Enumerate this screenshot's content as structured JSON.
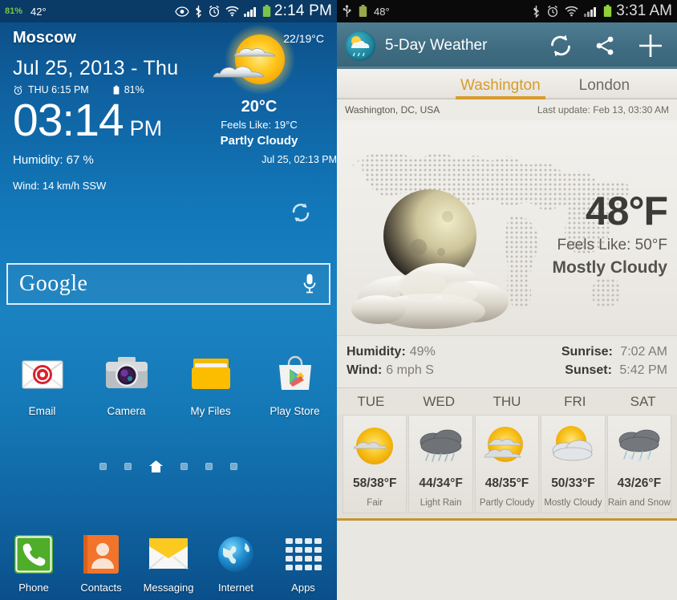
{
  "left_phone": {
    "status_bar": {
      "battery_percent": "81%",
      "outside_temp": "42°",
      "clock": "2:14 PM",
      "icons": [
        "eye-icon",
        "bluetooth-icon",
        "alarm-icon",
        "wifi-icon",
        "signal-icon",
        "battery-icon"
      ]
    },
    "weather_widget": {
      "city": "Moscow",
      "high_low": "22/19°C",
      "date": "Jul 25, 2013 - Thu",
      "alarm_time": "THU 6:15 PM",
      "battery": "81%",
      "clock_time": "03:14",
      "clock_ampm": "PM",
      "humidity": "Humidity: 67 %",
      "wind": "Wind: 14 km/h SSW",
      "temp": "20°C",
      "feels_like": "Feels Like: 19°C",
      "condition": "Partly Cloudy",
      "last_update": "Jul 25, 02:13 PM",
      "condition_icon": "sun-behind-clouds-icon",
      "refresh_icon": "refresh-icon"
    },
    "search_bar": {
      "label": "Google",
      "mic_icon": "microphone-icon"
    },
    "apps": [
      {
        "label": "Email",
        "icon": "email-icon"
      },
      {
        "label": "Camera",
        "icon": "camera-icon"
      },
      {
        "label": "My Files",
        "icon": "folder-icon"
      },
      {
        "label": "Play Store",
        "icon": "play-store-icon"
      }
    ],
    "page_indicator": {
      "count": 6,
      "home_index": 2,
      "home_icon": "home-icon"
    },
    "dock": [
      {
        "label": "Phone",
        "icon": "phone-icon"
      },
      {
        "label": "Contacts",
        "icon": "contacts-icon"
      },
      {
        "label": "Messaging",
        "icon": "messaging-icon"
      },
      {
        "label": "Internet",
        "icon": "globe-icon"
      },
      {
        "label": "Apps",
        "icon": "apps-grid-icon"
      }
    ]
  },
  "right_phone": {
    "status_bar": {
      "usb_icon": "usb-icon",
      "battery_icon": "battery-icon",
      "outside_temp": "48°",
      "clock": "3:31 AM",
      "icons": [
        "bluetooth-icon",
        "alarm-icon",
        "wifi-icon",
        "signal-icon",
        "battery-icon"
      ]
    },
    "app_bar": {
      "title": "5-Day Weather",
      "app_icon": "weather-app-icon",
      "actions": [
        {
          "name": "refresh-icon",
          "label": "Refresh"
        },
        {
          "name": "share-icon",
          "label": "Share"
        },
        {
          "name": "plus-icon",
          "label": "Add"
        }
      ]
    },
    "tabs": [
      {
        "label": "Washington",
        "active": true
      },
      {
        "label": "London",
        "active": false
      }
    ],
    "location_line": {
      "location": "Washington, DC, USA",
      "last_update": "Last update: Feb 13, 03:30 AM"
    },
    "current": {
      "temperature": "48°F",
      "feels_like": "Feels Like: 50°F",
      "condition": "Mostly Cloudy",
      "hero_icon": "moon-behind-clouds-icon",
      "background": "dotted-world-map"
    },
    "stats": {
      "humidity_label": "Humidity:",
      "humidity_value": "49%",
      "wind_label": "Wind:",
      "wind_value": "6 mph S",
      "sunrise_label": "Sunrise:",
      "sunrise_value": "7:02 AM",
      "sunset_label": "Sunset:",
      "sunset_value": "5:42 PM"
    },
    "forecast": [
      {
        "day": "TUE",
        "temps": "58/38°F",
        "desc": "Fair",
        "icon": "sun-cloud-icon"
      },
      {
        "day": "WED",
        "temps": "44/34°F",
        "desc": "Light Rain",
        "icon": "rain-cloud-icon"
      },
      {
        "day": "THU",
        "temps": "48/35°F",
        "desc": "Partly Cloudy",
        "icon": "sun-cloud-icon"
      },
      {
        "day": "FRI",
        "temps": "50/33°F",
        "desc": "Mostly Cloudy",
        "icon": "cloud-sun-icon"
      },
      {
        "day": "SAT",
        "temps": "43/26°F",
        "desc": "Rain and Snow",
        "icon": "rain-snow-icon"
      }
    ]
  },
  "colors": {
    "left_bg_top": "#0b4a80",
    "left_bg_mid": "#1b82c2",
    "status_bar_left": "#0a3a66",
    "status_bar_right": "#0a0a0a",
    "app_bar": "#406c81",
    "tab_active": "#d79b2a",
    "panel_bg": "#eae8e3",
    "nav_bar": "#3a3a3a",
    "battery_green": "#7cc34a"
  }
}
